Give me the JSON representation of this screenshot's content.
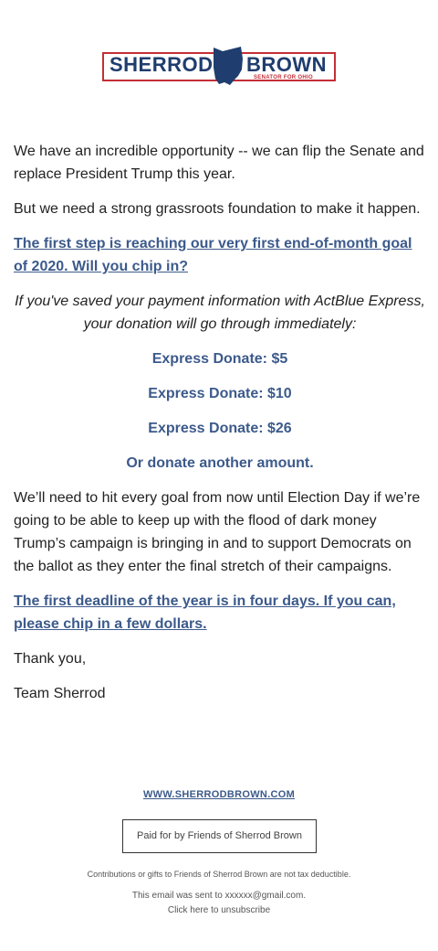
{
  "logo": {
    "left_text": "SHERROD",
    "right_text": "BROWN",
    "subtitle": "SENATOR FOR OHIO",
    "colors": {
      "navy": "#1f3d6e",
      "red": "#c42e37"
    }
  },
  "body": {
    "p1": "We have an incredible opportunity -- we can flip the Senate and replace President Trump this year.",
    "p2": "But we need a strong grassroots foundation to make it happen.",
    "link1": "The first step is reaching our very first end-of-month goal of 2020. Will you chip in?",
    "italic_note": "If you've saved your payment information with ActBlue Express, your donation will go through immediately:",
    "donate_5": "Express Donate: $5",
    "donate_10": "Express Donate: $10",
    "donate_26": "Express Donate: $26",
    "donate_other": "Or donate another amount.",
    "p3": "We’ll need to hit every goal from now until Election Day if we’re going to be able to keep up with the flood of dark money Trump’s campaign is bringing in and to support Democrats on the ballot as they enter the final stretch of their campaigns.",
    "link2": "The first deadline of the year is in four days. If you can, please chip in a few dollars.",
    "closing": "Thank you,",
    "signature": "Team Sherrod"
  },
  "footer": {
    "website": "WWW.SHERRODBROWN.COM",
    "paid_for": "Paid for by Friends of Sherrod Brown",
    "disclaimer": "Contributions or gifts to Friends of Sherrod Brown are not tax deductible.",
    "sent_to": "This email was sent to xxxxxx@gmail.com.",
    "unsubscribe": "Click here to unsubscribe"
  },
  "colors": {
    "link": "#3c5a8b",
    "text": "#222222"
  }
}
